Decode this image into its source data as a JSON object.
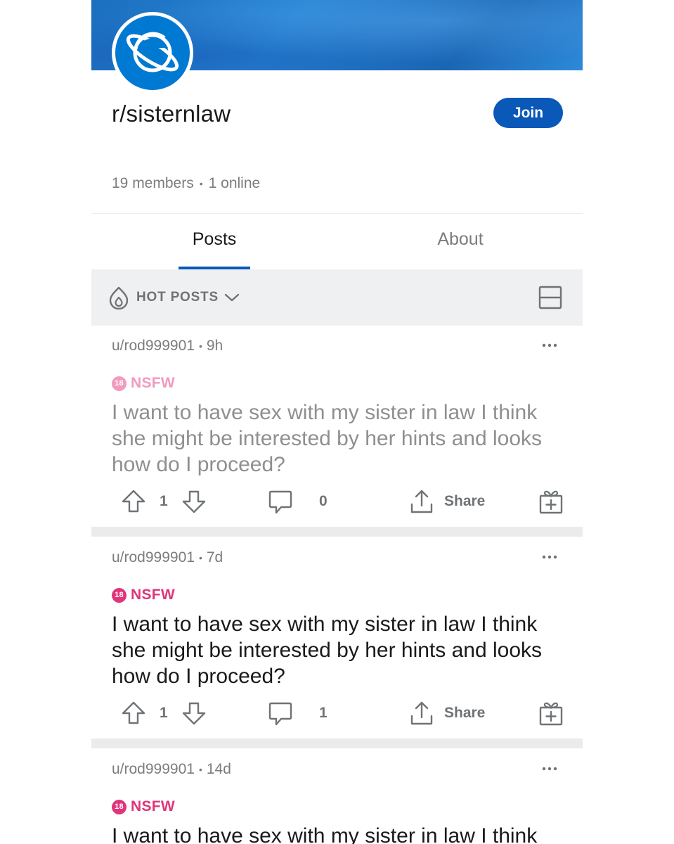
{
  "community": {
    "name": "r/sisternlaw",
    "join_label": "Join",
    "members": "19 members",
    "online": "1 online",
    "separator": "•"
  },
  "tabs": [
    {
      "label": "Posts",
      "active": true
    },
    {
      "label": "About",
      "active": false
    }
  ],
  "sort": {
    "label": "HOT POSTS",
    "icon": "flame-icon",
    "dropdown_icon": "chevron-down-icon",
    "layout_icon": "card-layout-icon"
  },
  "colors": {
    "accent": "#0a58b8",
    "nsfw": "#e0357a",
    "muted": "#7c7c7c"
  },
  "posts": [
    {
      "author": "u/rod999901",
      "age": "9h",
      "flag": "NSFW",
      "badge": "18",
      "title": "I want to have sex with my sister in law I think she might be interested by her hints and looks how do I proceed?",
      "upvotes": "1",
      "comments": "0",
      "share_label": "Share",
      "read": true
    },
    {
      "author": "u/rod999901",
      "age": "7d",
      "flag": "NSFW",
      "badge": "18",
      "title": "I want to have sex with my sister in law I think she might be interested by her hints and looks how do I proceed?",
      "upvotes": "1",
      "comments": "1",
      "share_label": "Share",
      "read": false
    },
    {
      "author": "u/rod999901",
      "age": "14d",
      "flag": "NSFW",
      "badge": "18",
      "title": "I want to have sex with my sister in law I think",
      "read": false
    }
  ]
}
